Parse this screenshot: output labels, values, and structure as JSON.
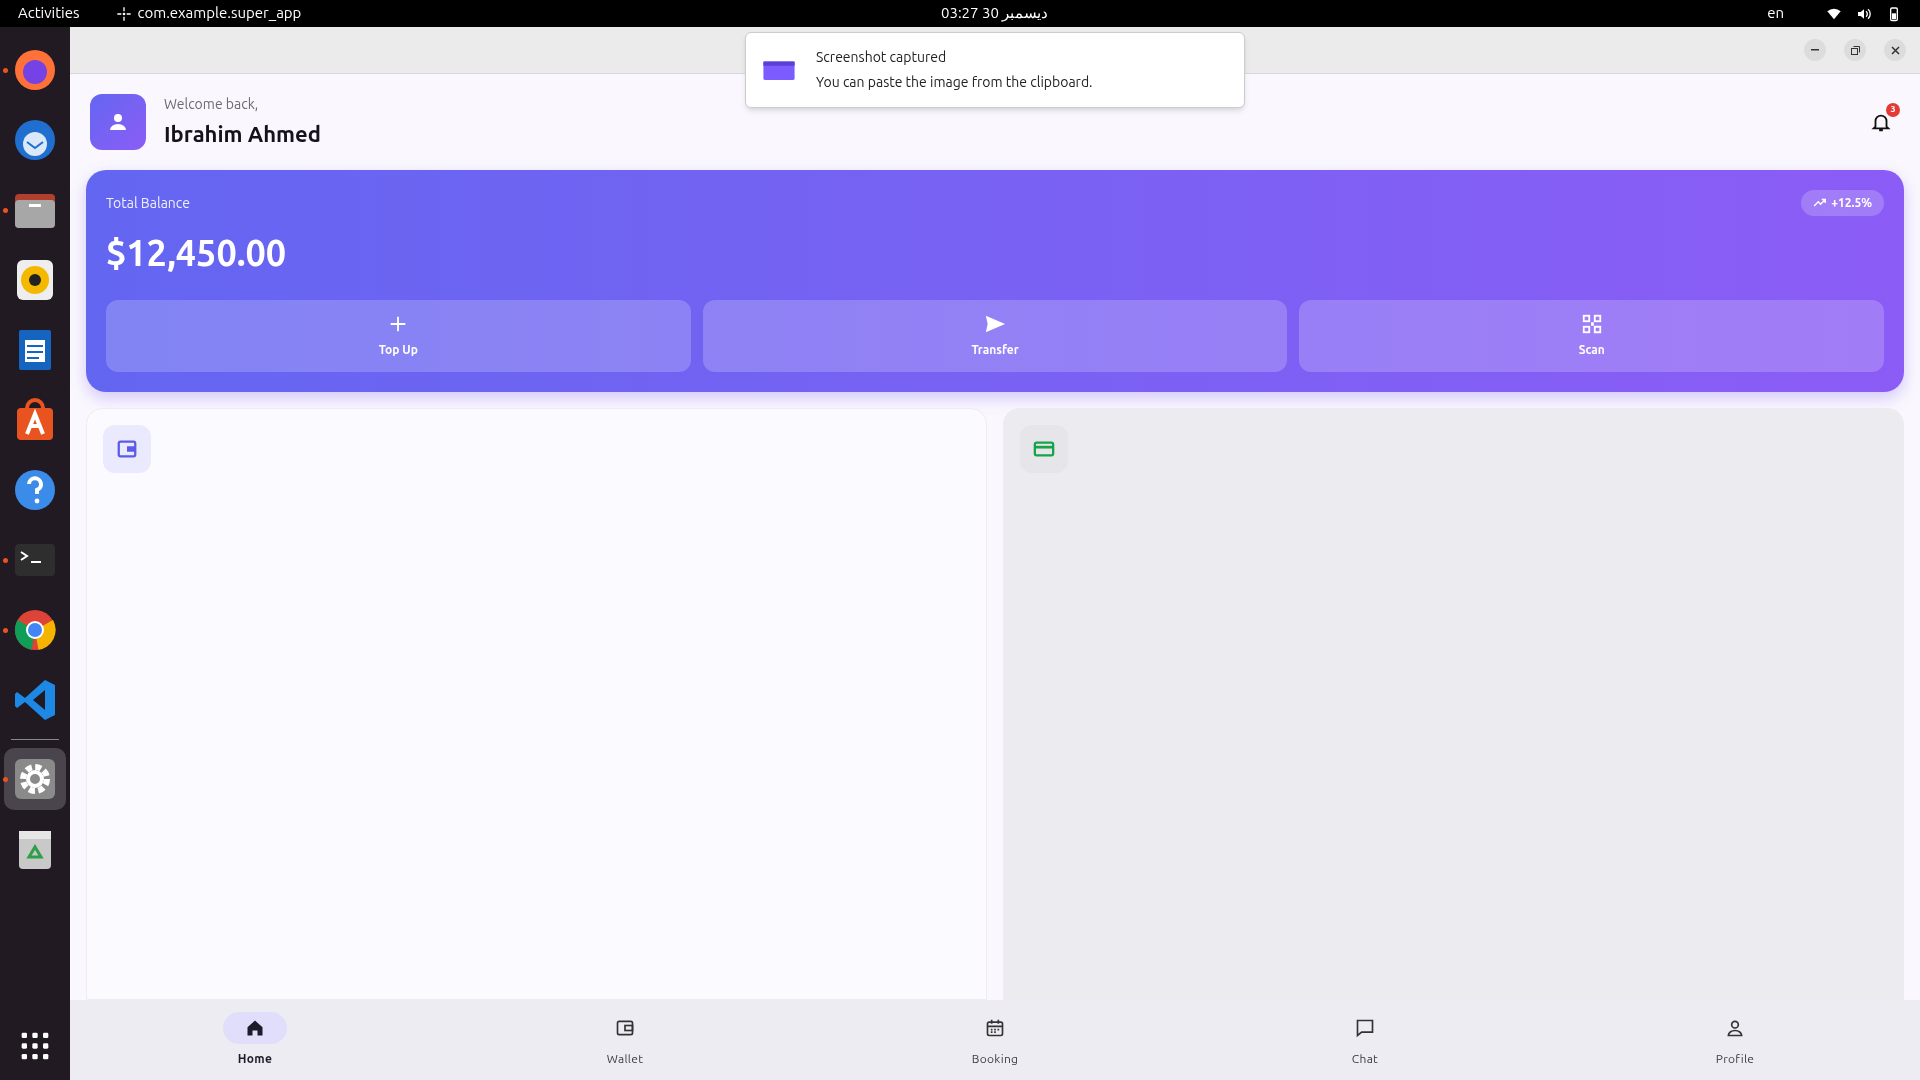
{
  "top_bar": {
    "activities": "Activities",
    "app_name": "com.example.super_app",
    "clock": "03:27  30 ديسمبر",
    "language": "en"
  },
  "dock": {
    "apps": [
      {
        "kind": "firefox",
        "running": true,
        "selected": false
      },
      {
        "kind": "thunderbird",
        "running": false,
        "selected": false
      },
      {
        "kind": "files",
        "running": true,
        "selected": false
      },
      {
        "kind": "rhythmbox",
        "running": false,
        "selected": false
      },
      {
        "kind": "writer",
        "running": false,
        "selected": false
      },
      {
        "kind": "appcenter",
        "running": false,
        "selected": false
      },
      {
        "kind": "help",
        "running": false,
        "selected": false
      },
      {
        "kind": "terminal",
        "running": true,
        "selected": false
      },
      {
        "kind": "chrome",
        "running": true,
        "selected": false
      },
      {
        "kind": "vscode",
        "running": false,
        "selected": false
      },
      {
        "kind": "settings",
        "running": true,
        "selected": true
      },
      {
        "kind": "trash",
        "running": false,
        "selected": false
      }
    ]
  },
  "notification": {
    "title": "Screenshot captured",
    "body": "You can paste the image from the clipboard."
  },
  "header": {
    "greeting": "Welcome back,",
    "user_name": "Ibrahim Ahmed",
    "notification_count": "3"
  },
  "balance_card": {
    "label": "Total Balance",
    "amount": "$12,450.00",
    "change": "+12.5%",
    "actions": [
      {
        "kind": "plus",
        "label": "Top Up"
      },
      {
        "kind": "send",
        "label": "Transfer"
      },
      {
        "kind": "scan",
        "label": "Scan"
      }
    ]
  },
  "panels": [
    {
      "kind": "wallet"
    },
    {
      "kind": "card"
    }
  ],
  "bottom_nav": [
    {
      "kind": "home",
      "label": "Home",
      "selected": true
    },
    {
      "kind": "wallet",
      "label": "Wallet",
      "selected": false
    },
    {
      "kind": "calendar",
      "label": "Booking",
      "selected": false
    },
    {
      "kind": "chat",
      "label": "Chat",
      "selected": false
    },
    {
      "kind": "profile",
      "label": "Profile",
      "selected": false
    }
  ]
}
